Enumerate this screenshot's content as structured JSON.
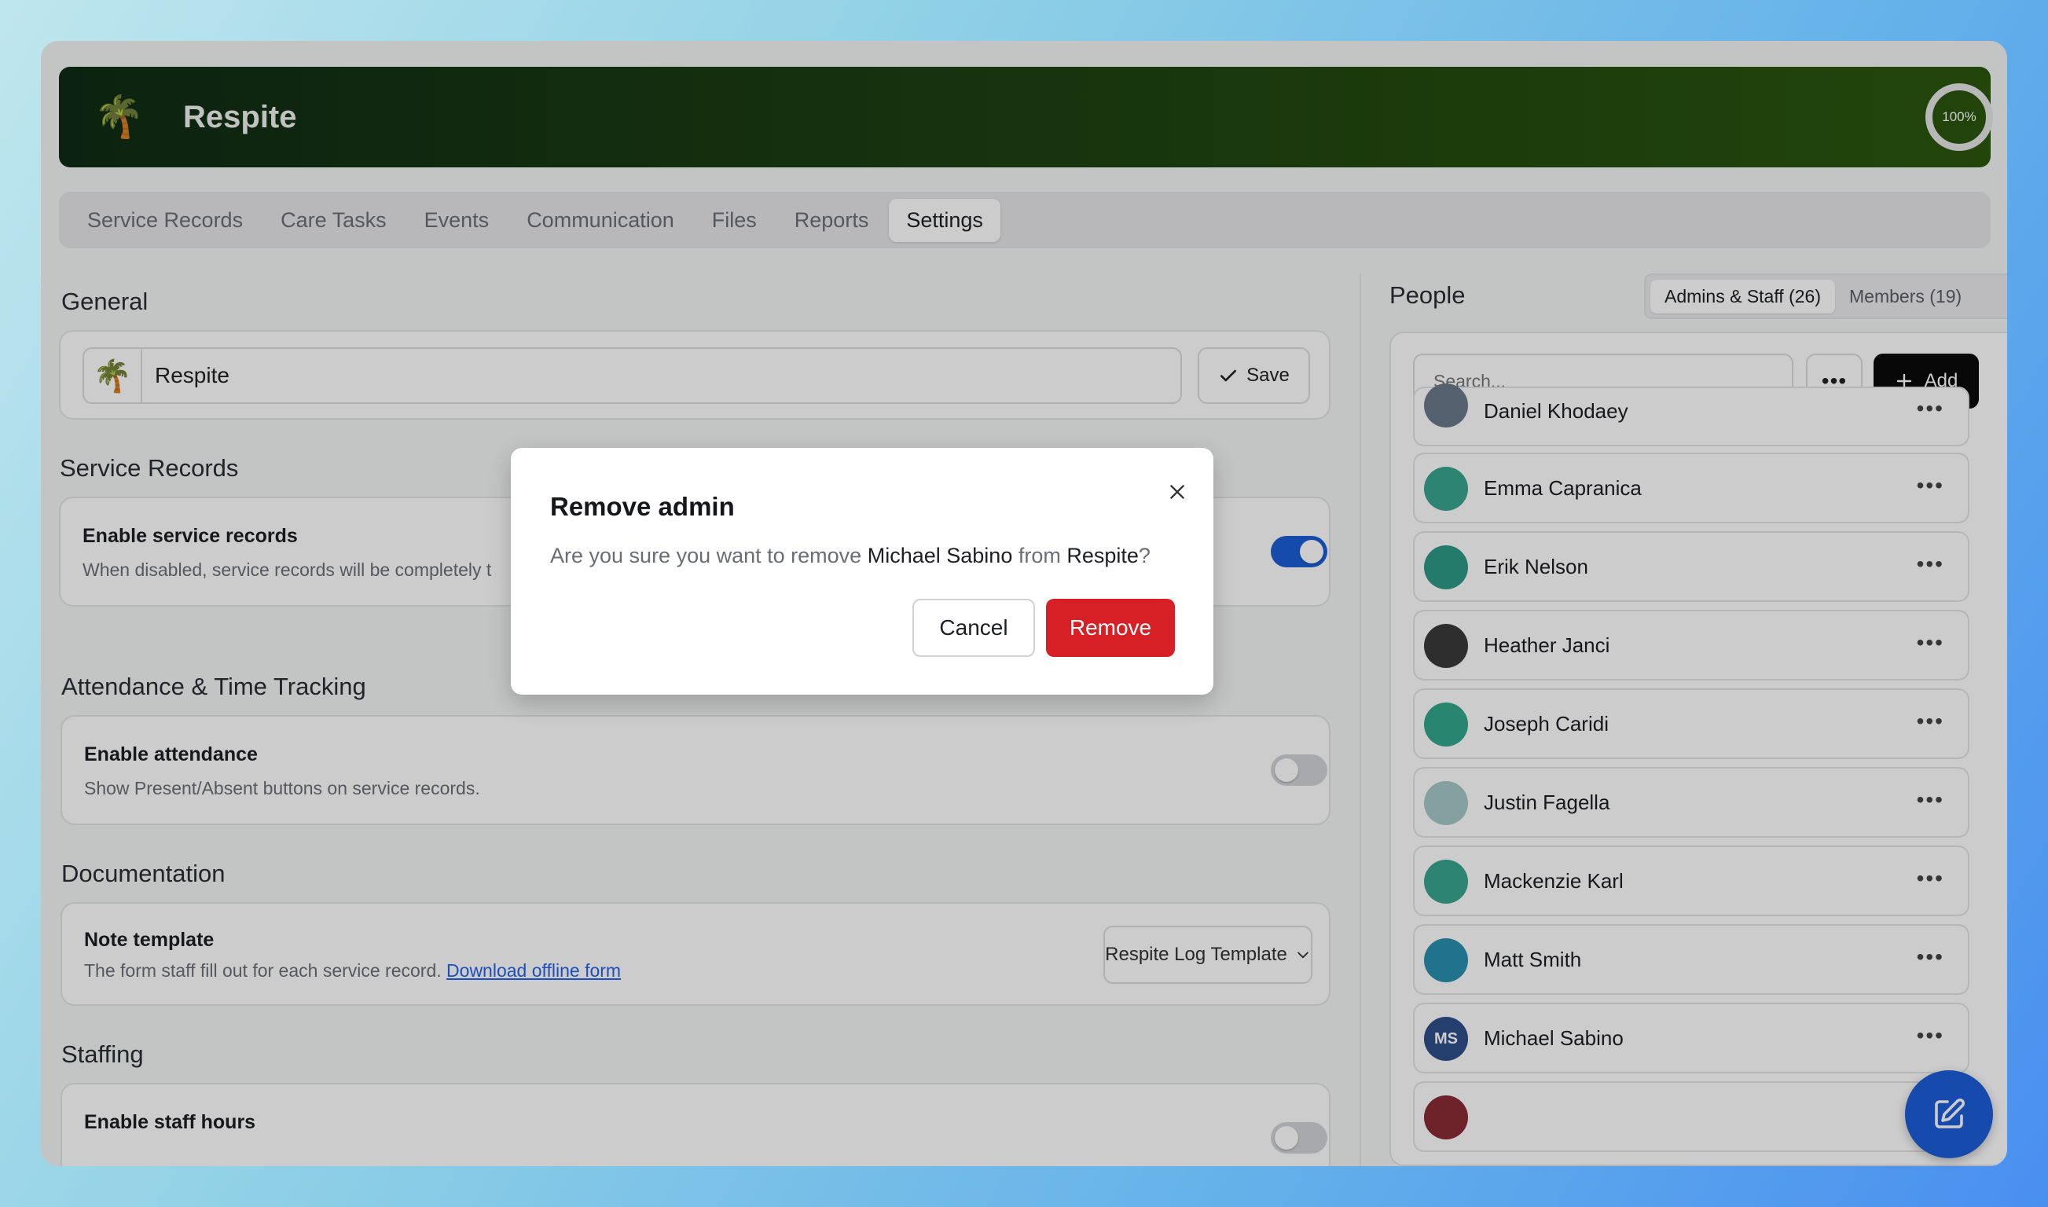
{
  "app": {
    "title": "Respite",
    "completion": "100%"
  },
  "tabs": [
    {
      "label": "Service Records"
    },
    {
      "label": "Care Tasks"
    },
    {
      "label": "Events"
    },
    {
      "label": "Communication"
    },
    {
      "label": "Files"
    },
    {
      "label": "Reports"
    },
    {
      "label": "Settings"
    }
  ],
  "general": {
    "heading": "General",
    "name_value": "Respite",
    "save_label": "Save"
  },
  "service_records": {
    "heading": "Service Records",
    "label": "Enable service records",
    "desc": "When disabled, service records will be completely t"
  },
  "attendance": {
    "heading": "Attendance & Time Tracking",
    "label": "Enable attendance",
    "desc": "Show Present/Absent buttons on service records."
  },
  "documentation": {
    "heading": "Documentation",
    "label": "Note template",
    "desc": "The form staff fill out for each service record.",
    "link": "Download offline form",
    "select_value": "Respite Log Template"
  },
  "staffing": {
    "heading": "Staffing",
    "label": "Enable staff hours"
  },
  "people": {
    "heading": "People",
    "tab_admins": "Admins & Staff (26)",
    "tab_members": "Members (19)",
    "search_placeholder": "Search...",
    "add_label": "Add",
    "list": [
      {
        "name": "Daniel Khodaey",
        "color": "#6b7a8a"
      },
      {
        "name": "Emma Capranica",
        "color": "#3aa58f"
      },
      {
        "name": "Erik Nelson",
        "color": "#2f9a86"
      },
      {
        "name": "Heather Janci",
        "color": "#3a3a3a"
      },
      {
        "name": "Joseph Caridi",
        "color": "#33a88c"
      },
      {
        "name": "Justin Fagella",
        "color": "#a6c9c9"
      },
      {
        "name": "Mackenzie Karl",
        "color": "#3aa58f"
      },
      {
        "name": "Matt Smith",
        "color": "#2a8fb0"
      },
      {
        "name": "Michael Sabino",
        "color": "#2d4e8a",
        "initials": "MS"
      }
    ]
  },
  "modal": {
    "title": "Remove admin",
    "body_prefix": "Are you sure you want to remove",
    "person": "Michael Sabino",
    "body_mid": "from",
    "group": "Respite",
    "body_suffix": "?",
    "cancel_label": "Cancel",
    "remove_label": "Remove"
  }
}
